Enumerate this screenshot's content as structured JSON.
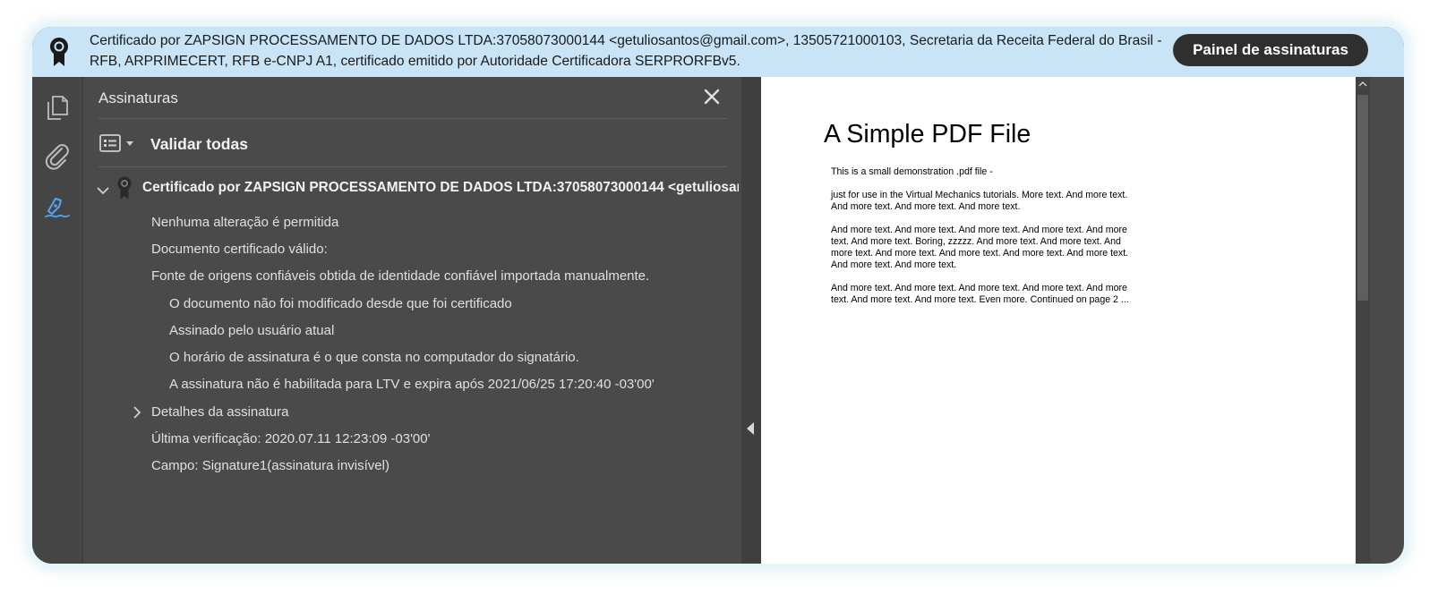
{
  "banner": {
    "message": "Certificado por ZAPSIGN PROCESSAMENTO DE DADOS LTDA:37058073000144 <getuliosantos@gmail.com>, 13505721000103, Secretaria da Receita Federal do Brasil - RFB, ARPRIMECERT, RFB e-CNPJ A1, certificado emitido por Autoridade Certificadora SERPRORFBv5.",
    "button_label": "Painel de assinaturas"
  },
  "nav": {
    "items": [
      "pages-icon",
      "attachment-icon",
      "signature-icon"
    ],
    "active_color": "#4ea6f5"
  },
  "signatures": {
    "title": "Assinaturas",
    "validate_all": "Validar todas",
    "certificate": "Certificado por ZAPSIGN PROCESSAMENTO DE DADOS LTDA:37058073000144 <getuliosantos@",
    "details": [
      "Nenhuma alteração é permitida",
      "Documento certificado válido:",
      "Fonte de origens confiáveis obtida de identidade confiável importada manualmente."
    ],
    "sub_details": [
      "O documento não foi modificado desde que foi certificado",
      "Assinado pelo usuário atual",
      "O horário de assinatura é o que consta no computador do signatário.",
      "A assinatura não é habilitada para LTV e expira após 2021/06/25 17:20:40 -03'00'"
    ],
    "signature_details_label": "Detalhes da assinatura",
    "last_check": "Última verificação: 2020.07.11 12:23:09 -03'00'",
    "field": "Campo: Signature1(assinatura invisível)"
  },
  "document": {
    "title": "A Simple PDF File",
    "paragraphs": [
      "This is a small demonstration .pdf file -",
      "just for use in the Virtual Mechanics tutorials. More text. And more text. And more text. And more text. And more text.",
      "And more text. And more text. And more text. And more text. And more text. And more text. Boring, zzzzz. And more text. And more text. And more text. And more text. And more text. And more text. And more text. And more text. And more text.",
      "And more text. And more text. And more text. And more text. And more text. And more text. And more text. Even more. Continued on page 2 ..."
    ]
  }
}
